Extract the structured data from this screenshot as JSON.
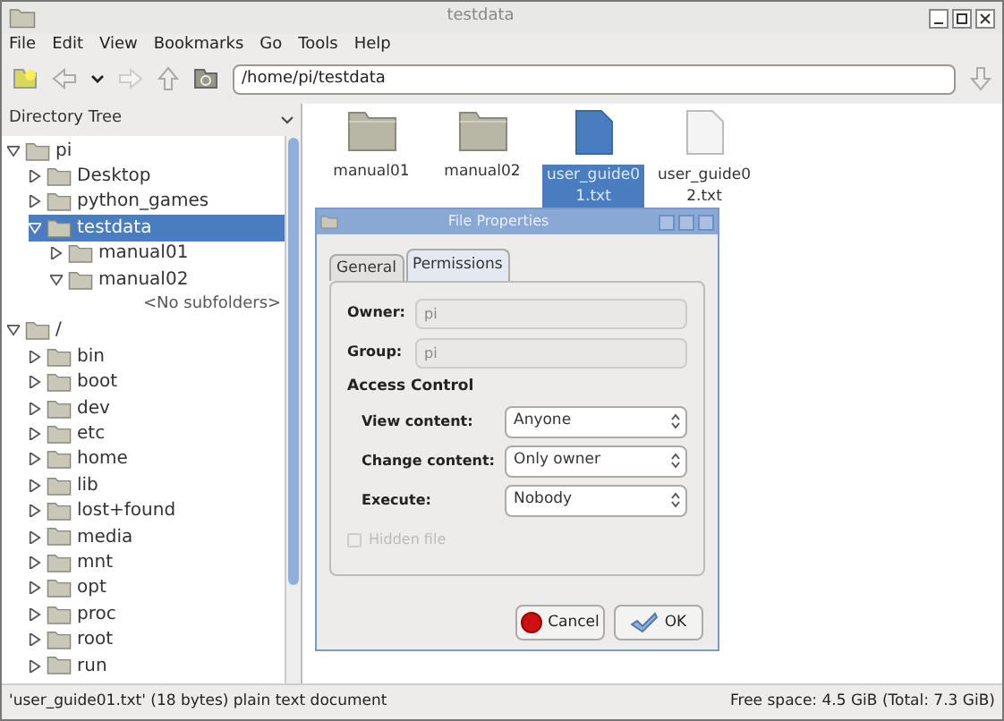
{
  "window": {
    "title": "testdata"
  },
  "menu": [
    "File",
    "Edit",
    "View",
    "Bookmarks",
    "Go",
    "Tools",
    "Help"
  ],
  "location": {
    "value": "/home/pi/testdata"
  },
  "sidebar": {
    "title": "Directory Tree",
    "tree": [
      {
        "label": "pi",
        "expanded": true,
        "selected": false,
        "children": [
          {
            "label": "Desktop",
            "expanded": false,
            "selected": false
          },
          {
            "label": "python_games",
            "expanded": false,
            "selected": false
          },
          {
            "label": "testdata",
            "expanded": true,
            "selected": true,
            "children": [
              {
                "label": "manual01",
                "expanded": false,
                "selected": false
              },
              {
                "label": "manual02",
                "expanded": true,
                "selected": false,
                "children": [
                  {
                    "label": "<No subfolders>",
                    "kind": "note"
                  }
                ]
              }
            ]
          }
        ]
      },
      {
        "label": "/",
        "expanded": true,
        "selected": false,
        "children": [
          {
            "label": "bin",
            "expanded": false,
            "selected": false
          },
          {
            "label": "boot",
            "expanded": false,
            "selected": false
          },
          {
            "label": "dev",
            "expanded": false,
            "selected": false
          },
          {
            "label": "etc",
            "expanded": false,
            "selected": false
          },
          {
            "label": "home",
            "expanded": false,
            "selected": false
          },
          {
            "label": "lib",
            "expanded": false,
            "selected": false
          },
          {
            "label": "lost+found",
            "expanded": false,
            "selected": false
          },
          {
            "label": "media",
            "expanded": false,
            "selected": false
          },
          {
            "label": "mnt",
            "expanded": false,
            "selected": false
          },
          {
            "label": "opt",
            "expanded": false,
            "selected": false
          },
          {
            "label": "proc",
            "expanded": false,
            "selected": false
          },
          {
            "label": "root",
            "expanded": false,
            "selected": false
          },
          {
            "label": "run",
            "expanded": false,
            "selected": false
          }
        ]
      }
    ]
  },
  "files": [
    {
      "name": "manual01",
      "kind": "folder",
      "selected": false
    },
    {
      "name": "manual02",
      "kind": "folder",
      "selected": false
    },
    {
      "name": "user_guide01.txt",
      "kind": "text",
      "selected": true
    },
    {
      "name": "user_guide02.txt",
      "kind": "text",
      "selected": false
    }
  ],
  "dialog": {
    "title": "File Properties",
    "tabs": [
      {
        "label": "General",
        "selected": false
      },
      {
        "label": "Permissions",
        "selected": true
      }
    ],
    "fields": [
      {
        "label": "Owner:",
        "value": "pi",
        "disabled": true
      },
      {
        "label": "Group:",
        "value": "pi",
        "disabled": true
      }
    ],
    "section": "Access Control",
    "selects": [
      {
        "label": "View content:",
        "value": "Anyone"
      },
      {
        "label": "Change content:",
        "value": "Only owner"
      },
      {
        "label": "Execute:",
        "value": "Nobody"
      }
    ],
    "hidden_file": {
      "label": "Hidden file",
      "checked": false,
      "disabled": true
    },
    "buttons": [
      {
        "label": "Cancel",
        "kind": "cancel"
      },
      {
        "label": "OK",
        "kind": "ok"
      }
    ]
  },
  "status_bar": {
    "left": "'user_guide01.txt' (18 bytes) plain text document",
    "right": "Free space: 4.5 GiB (Total: 7.3 GiB)"
  }
}
